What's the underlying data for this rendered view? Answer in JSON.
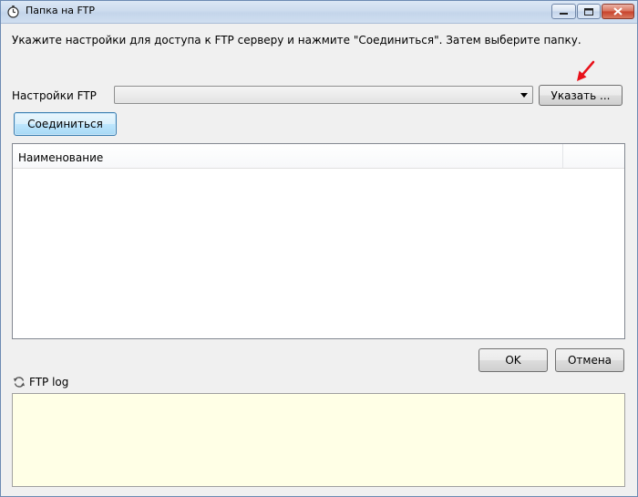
{
  "window": {
    "title": "Папка на FTP"
  },
  "instruction": "Укажите настройки для доступа к FTP серверу и нажмите \"Соединиться\". Затем выберите папку.",
  "ftp_settings": {
    "label": "Настройки FTP",
    "selected_value": "",
    "specify_button": "Указать ..."
  },
  "connect_button": "Соединиться",
  "list": {
    "columns": [
      "Наименование"
    ],
    "rows": []
  },
  "ok_button": "OK",
  "cancel_button": "Отмена",
  "log": {
    "label": "FTP log",
    "content": ""
  },
  "colors": {
    "annotation_arrow": "#e8111a",
    "log_background": "#ffffe6"
  },
  "icons": {
    "title": "stopwatch-icon",
    "log": "refresh-icon"
  }
}
